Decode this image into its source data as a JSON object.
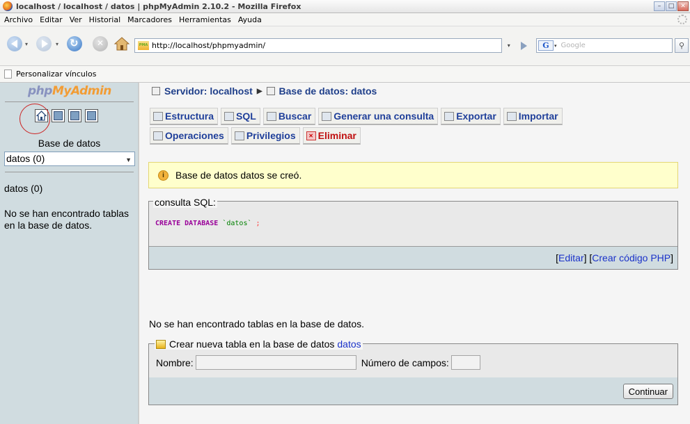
{
  "window": {
    "title": "localhost / localhost / datos | phpMyAdmin 2.10.2 - Mozilla Firefox"
  },
  "menu": {
    "items": [
      "Archivo",
      "Editar",
      "Ver",
      "Historial",
      "Marcadores",
      "Herramientas",
      "Ayuda"
    ]
  },
  "nav": {
    "url": "http://localhost/phpmyadmin/",
    "search_placeholder": "Google",
    "favicon_label": "PMA"
  },
  "bookmarks": {
    "label": "Personalizar vínculos"
  },
  "sidebar": {
    "logo_php": "php",
    "logo_myadmin": "MyAdmin",
    "db_label": "Base de datos",
    "db_select": "datos (0)",
    "db_name": "datos (0)",
    "no_tables": "No se han encontrado tablas en la base de datos."
  },
  "breadcrumb": {
    "server": "Servidor: localhost",
    "database": "Base de datos: datos"
  },
  "tabs": {
    "row1": [
      "Estructura",
      "SQL",
      "Buscar",
      "Generar una consulta",
      "Exportar",
      "Importar"
    ],
    "row2": [
      "Operaciones",
      "Privilegios",
      "Eliminar"
    ]
  },
  "notice": {
    "message": "Base de datos datos se creó."
  },
  "sql": {
    "legend": "consulta SQL:",
    "keyword": "CREATE DATABASE",
    "string": "`datos`",
    "end": ";",
    "open_bracket": "[",
    "edit": "Editar",
    "mid_bracket": "] [",
    "create_php": "Crear código PHP",
    "close_bracket": "]"
  },
  "main": {
    "no_tables": "No se han encontrado tablas en la base de datos."
  },
  "create_table": {
    "legend": "Crear nueva tabla en la base de datos",
    "db_link": "datos",
    "name_label": "Nombre:",
    "fields_label": "Número de campos:",
    "name_value": "",
    "fields_value": "",
    "submit": "Continuar"
  },
  "colors": {
    "link": "#1a32c9",
    "tab_text": "#1f3f9a",
    "danger": "#c01010",
    "sidebar_bg": "#d0dce0",
    "notice_bg": "#ffffcc"
  }
}
